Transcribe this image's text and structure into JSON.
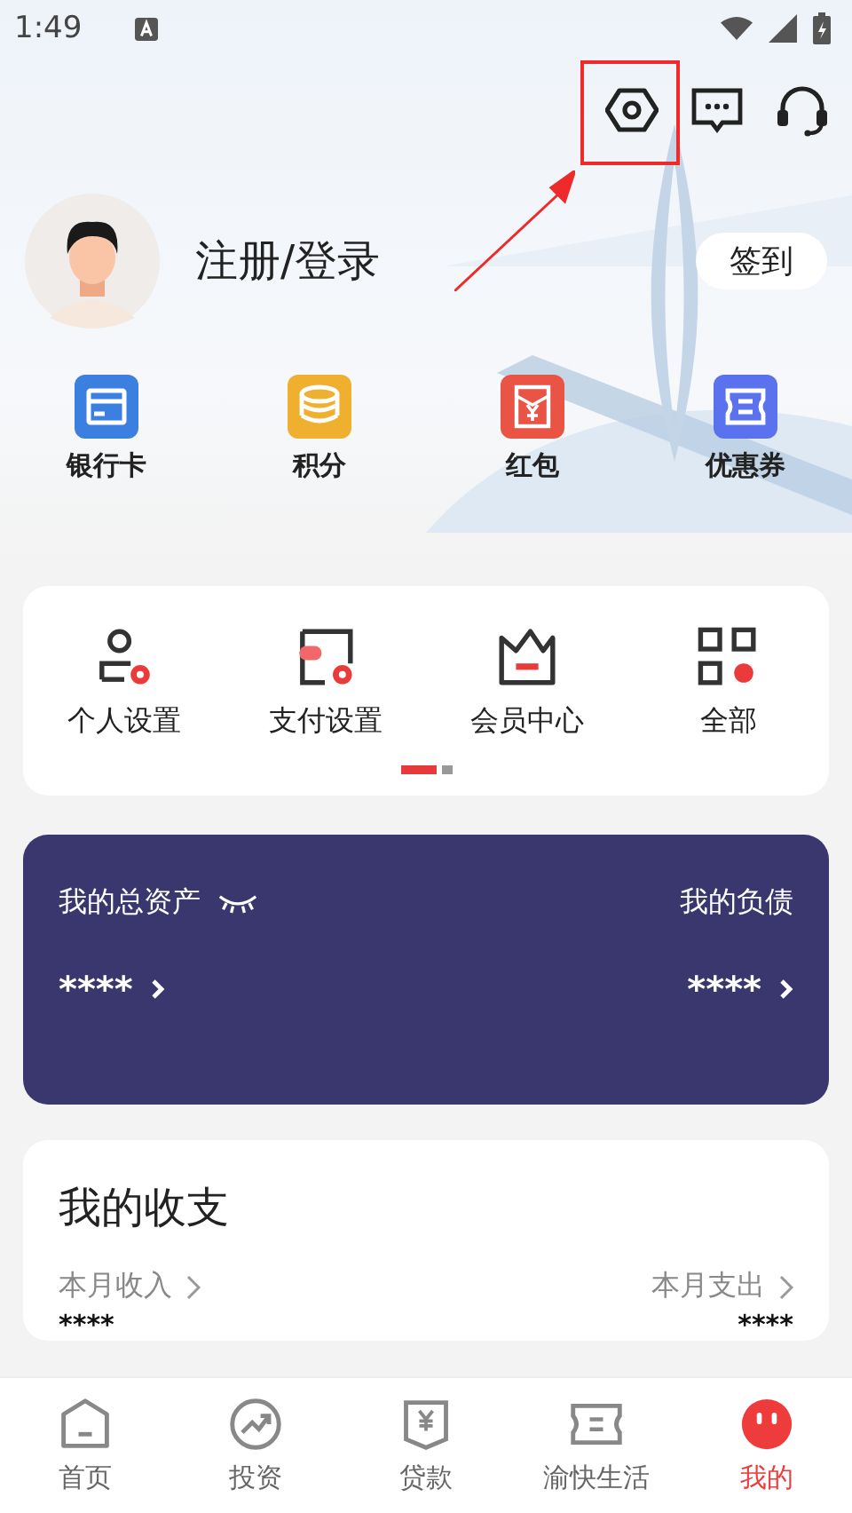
{
  "status_bar": {
    "time": "1:49"
  },
  "user": {
    "login": "注册/登录",
    "checkin_button": "签到"
  },
  "shortcuts": [
    {
      "label": "银行卡",
      "kind": "card"
    },
    {
      "label": "积分",
      "kind": "coins"
    },
    {
      "label": "红包",
      "kind": "redpacket"
    },
    {
      "label": "优惠券",
      "kind": "coupon"
    }
  ],
  "services": {
    "items": [
      {
        "label": "个人设置",
        "kind": "person"
      },
      {
        "label": "支付设置",
        "kind": "wallet"
      },
      {
        "label": "会员中心",
        "kind": "crown"
      },
      {
        "label": "全部",
        "kind": "grid"
      }
    ],
    "pages": [
      {
        "selected": true
      },
      {
        "selected": false
      }
    ]
  },
  "assets": {
    "total_label": "我的总资产",
    "values_hidden": true,
    "total_value": "****",
    "liabilities_label": "我的负债",
    "liabilities_value": "****"
  },
  "income": {
    "title": "我的收支",
    "income_label": "本月收入",
    "income_value": "****",
    "expense_label": "本月支出",
    "expense_value": "****"
  },
  "tabs": [
    {
      "label": "首页",
      "kind": "home",
      "selected": false
    },
    {
      "label": "投资",
      "kind": "invest",
      "selected": false
    },
    {
      "label": "贷款",
      "kind": "loan",
      "selected": false
    },
    {
      "label": "渝快生活",
      "kind": "life",
      "selected": false
    },
    {
      "label": "我的",
      "kind": "mine",
      "selected": true
    }
  ]
}
